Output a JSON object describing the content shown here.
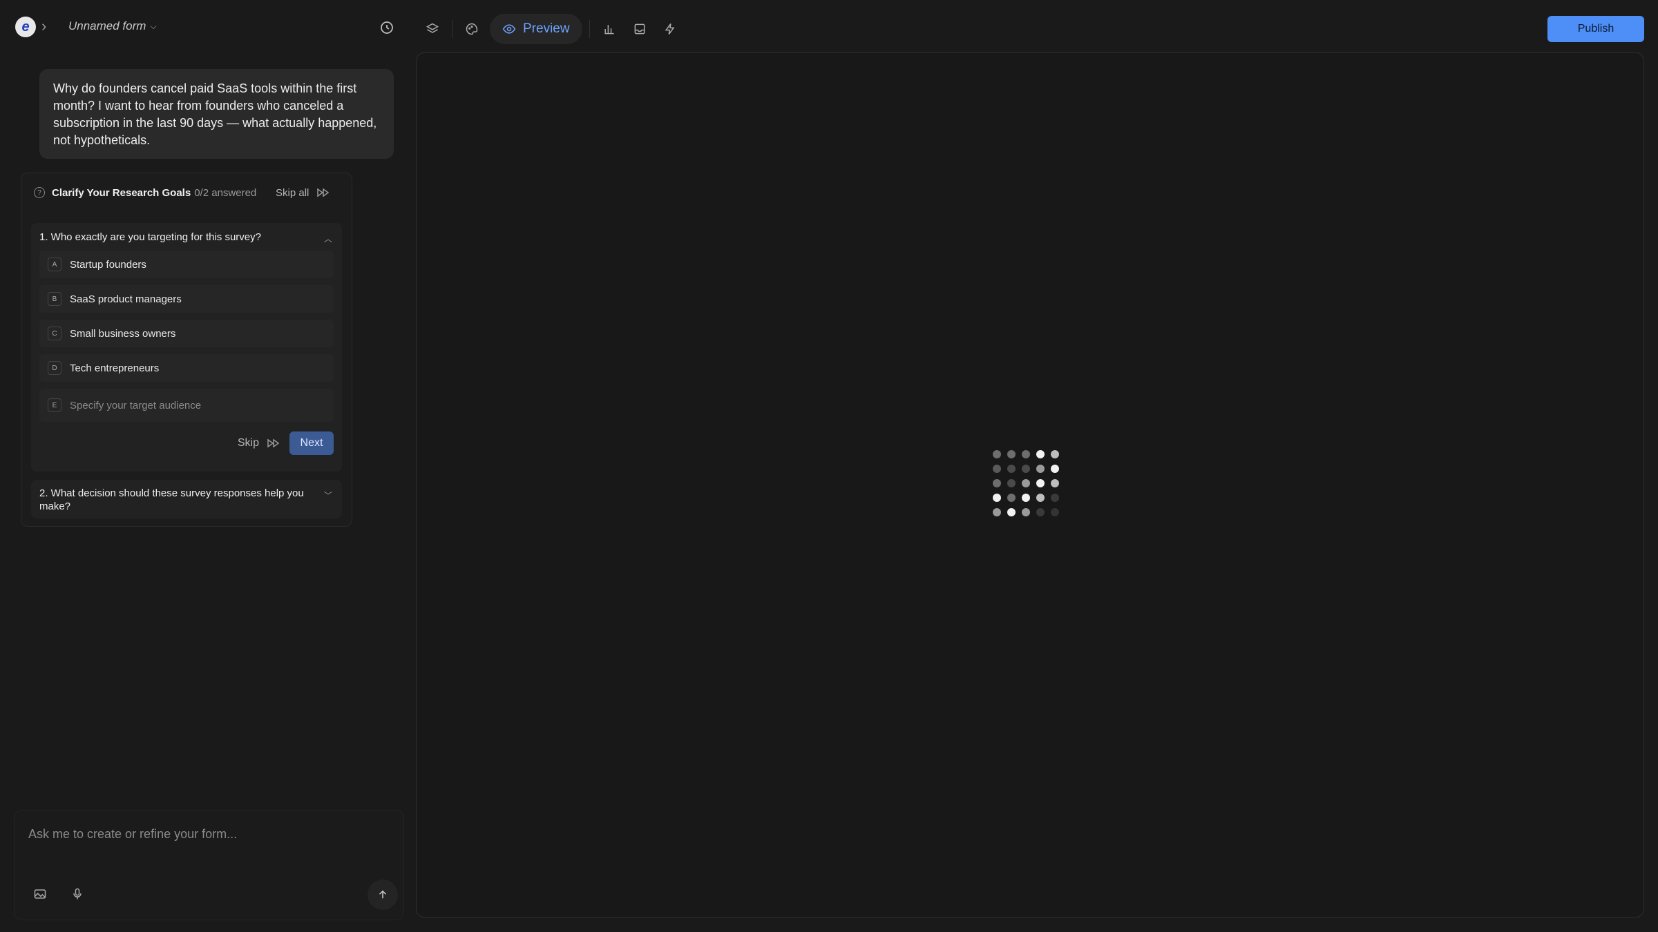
{
  "header": {
    "logo_letter": "e",
    "form_name": "Unnamed form",
    "preview_label": "Preview",
    "publish_label": "Publish"
  },
  "prompt": {
    "text": "Why do founders cancel paid SaaS tools within the first month? I want to hear from founders who canceled a subscription in the last 90 days — what actually happened, not hypotheticals."
  },
  "clarify": {
    "title": "Clarify Your Research Goals",
    "count": "0/2 answered",
    "skip_all": "Skip all",
    "q1": {
      "title": "1. Who exactly are you targeting for this survey?",
      "options": [
        {
          "key": "A",
          "label": "Startup founders"
        },
        {
          "key": "B",
          "label": "SaaS product managers"
        },
        {
          "key": "C",
          "label": "Small business owners"
        },
        {
          "key": "D",
          "label": "Tech entrepreneurs"
        }
      ],
      "custom": {
        "key": "E",
        "placeholder": "Specify your target audience"
      },
      "skip": "Skip",
      "next": "Next"
    },
    "q2": {
      "title": "2. What decision should these survey responses help you make?"
    }
  },
  "chat": {
    "placeholder": "Ask me to create or refine your form..."
  },
  "colors": {
    "accent": "#4d8ef7",
    "preview_text": "#6ea2ff",
    "next_button": "#3c5a94"
  }
}
